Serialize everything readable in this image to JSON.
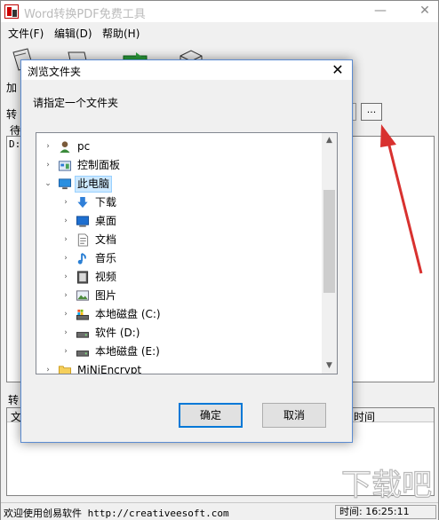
{
  "window": {
    "title": "Word转换PDF免费工具",
    "minimize": "—",
    "close": "✕"
  },
  "menu": [
    "文件(F)",
    "编辑(D)",
    "帮助(H)"
  ],
  "toolbar": {
    "add_label": "加",
    "convert_label": "转",
    "pending_label": "待",
    "path_fragment": "D:",
    "browse_label": "...",
    "bottom_label": "转",
    "bottom_col_left": "文",
    "bottom_col_time": "时间"
  },
  "status": {
    "left": "欢迎使用创易软件 http://creativeesoft.com",
    "right": "时间: 16:25:11"
  },
  "dialog": {
    "title": "浏览文件夹",
    "close": "✕",
    "prompt": "请指定一个文件夹",
    "ok": "确定",
    "cancel": "取消",
    "tree": [
      {
        "label": "pc",
        "icon": "user-icon",
        "level": 0,
        "expand": "collapsed"
      },
      {
        "label": "控制面板",
        "icon": "control-panel-icon",
        "level": 0,
        "expand": "collapsed"
      },
      {
        "label": "此电脑",
        "icon": "computer-icon",
        "level": 0,
        "expand": "expanded",
        "selected": true
      },
      {
        "label": "下载",
        "icon": "download-icon",
        "level": 1,
        "expand": "collapsed"
      },
      {
        "label": "桌面",
        "icon": "desktop-icon",
        "level": 1,
        "expand": "collapsed"
      },
      {
        "label": "文档",
        "icon": "document-icon",
        "level": 1,
        "expand": "collapsed"
      },
      {
        "label": "音乐",
        "icon": "music-icon",
        "level": 1,
        "expand": "collapsed"
      },
      {
        "label": "视频",
        "icon": "video-icon",
        "level": 1,
        "expand": "collapsed"
      },
      {
        "label": "图片",
        "icon": "picture-icon",
        "level": 1,
        "expand": "collapsed"
      },
      {
        "label": "本地磁盘 (C:)",
        "icon": "system-drive-icon",
        "level": 1,
        "expand": "collapsed"
      },
      {
        "label": "软件 (D:)",
        "icon": "drive-icon",
        "level": 1,
        "expand": "collapsed"
      },
      {
        "label": "本地磁盘 (E:)",
        "icon": "drive-icon",
        "level": 1,
        "expand": "collapsed"
      },
      {
        "label": "MiNiEncrypt",
        "icon": "folder-icon",
        "level": 0,
        "expand": "collapsed"
      }
    ]
  },
  "watermark": "下载吧",
  "colors": {
    "accent": "#0078d7",
    "selection": "#cce8ff",
    "arrow": "#d8312f"
  }
}
